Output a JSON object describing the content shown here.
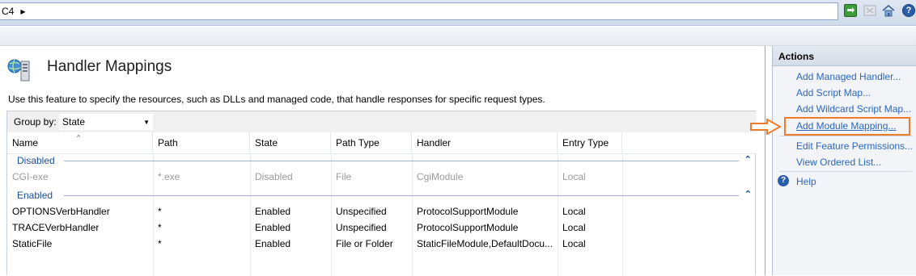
{
  "address_bar": {
    "path": "C4"
  },
  "page": {
    "title": "Handler Mappings",
    "description": "Use this feature to specify the resources, such as DLLs and managed code, that handle responses for specific request types."
  },
  "groupby": {
    "label": "Group by:",
    "value": "State"
  },
  "columns": [
    "Name",
    "Path",
    "State",
    "Path Type",
    "Handler",
    "Entry Type"
  ],
  "groups": [
    {
      "label": "Disabled",
      "rows": [
        {
          "name": "CGI-exe",
          "path": "*.exe",
          "state": "Disabled",
          "path_type": "File",
          "handler": "CgiModule",
          "entry_type": "Local"
        }
      ]
    },
    {
      "label": "Enabled",
      "rows": [
        {
          "name": "OPTIONSVerbHandler",
          "path": "*",
          "state": "Enabled",
          "path_type": "Unspecified",
          "handler": "ProtocolSupportModule",
          "entry_type": "Local"
        },
        {
          "name": "TRACEVerbHandler",
          "path": "*",
          "state": "Enabled",
          "path_type": "Unspecified",
          "handler": "ProtocolSupportModule",
          "entry_type": "Local"
        },
        {
          "name": "StaticFile",
          "path": "*",
          "state": "Enabled",
          "path_type": "File or Folder",
          "handler": "StaticFileModule,DefaultDocu...",
          "entry_type": "Local"
        }
      ]
    }
  ],
  "actions": {
    "title": "Actions",
    "items": [
      "Add Managed Handler...",
      "Add Script Map...",
      "Add Wildcard Script Map...",
      "Add Module Mapping...",
      "Edit Feature Permissions...",
      "View Ordered List..."
    ],
    "help": "Help"
  },
  "colors": {
    "link": "#2a66c2",
    "group": "#1b4fa3",
    "highlight": "#ec7b2a",
    "disabled_text": "#9a9a9a"
  }
}
